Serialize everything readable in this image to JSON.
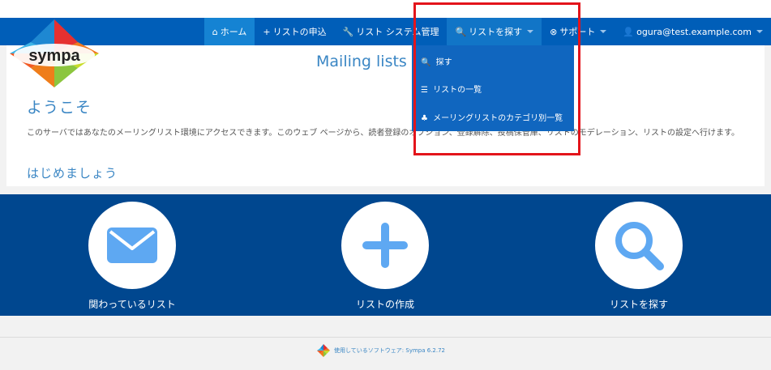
{
  "nav": {
    "items": [
      {
        "label": "ホーム",
        "icon": "home-icon",
        "glyph": "⌂"
      },
      {
        "label": "リストの申込",
        "icon": "plus-icon",
        "glyph": "+"
      },
      {
        "label": "リスト システム管理",
        "icon": "wrench-icon",
        "glyph": "🔧"
      },
      {
        "label": "リストを探す",
        "icon": "search-icon",
        "glyph": "🔍"
      },
      {
        "label": "サポート",
        "icon": "lifebuoy-icon",
        "glyph": "⊗"
      },
      {
        "label": "ogura@test.example.com",
        "icon": "user-icon",
        "glyph": "👤"
      }
    ]
  },
  "logo": {
    "text": "sympa"
  },
  "dropdown": {
    "items": [
      {
        "label": "探す",
        "icon": "search-icon",
        "glyph": "🔍"
      },
      {
        "label": "リストの一覧",
        "icon": "list-icon",
        "glyph": "☰"
      },
      {
        "label": "メーリングリストのカテゴリ別一覧",
        "icon": "sitemap-icon",
        "glyph": "♣"
      }
    ]
  },
  "main": {
    "title": "Mailing lists s",
    "welcome": "ようこそ",
    "description": "このサーバではあなたのメーリングリスト環境にアクセスできます。このウェブ ページから、読者登録のオプション、登録解除、投稿保管庫、リストのモデレーション、リストの設定へ行けます。",
    "start": "はじめましょう"
  },
  "features": [
    {
      "label": "関わっているリスト",
      "icon": "envelope-icon"
    },
    {
      "label": "リストの作成",
      "icon": "plus-icon"
    },
    {
      "label": "リストを探す",
      "icon": "search-icon"
    }
  ],
  "footer": {
    "text": "使用しているソフトウェア: Sympa 6.2.72"
  },
  "colors": {
    "navbar": "#005eb8",
    "band": "#00478f",
    "icon": "#5ea8f2",
    "highlight": "#e3141b"
  }
}
